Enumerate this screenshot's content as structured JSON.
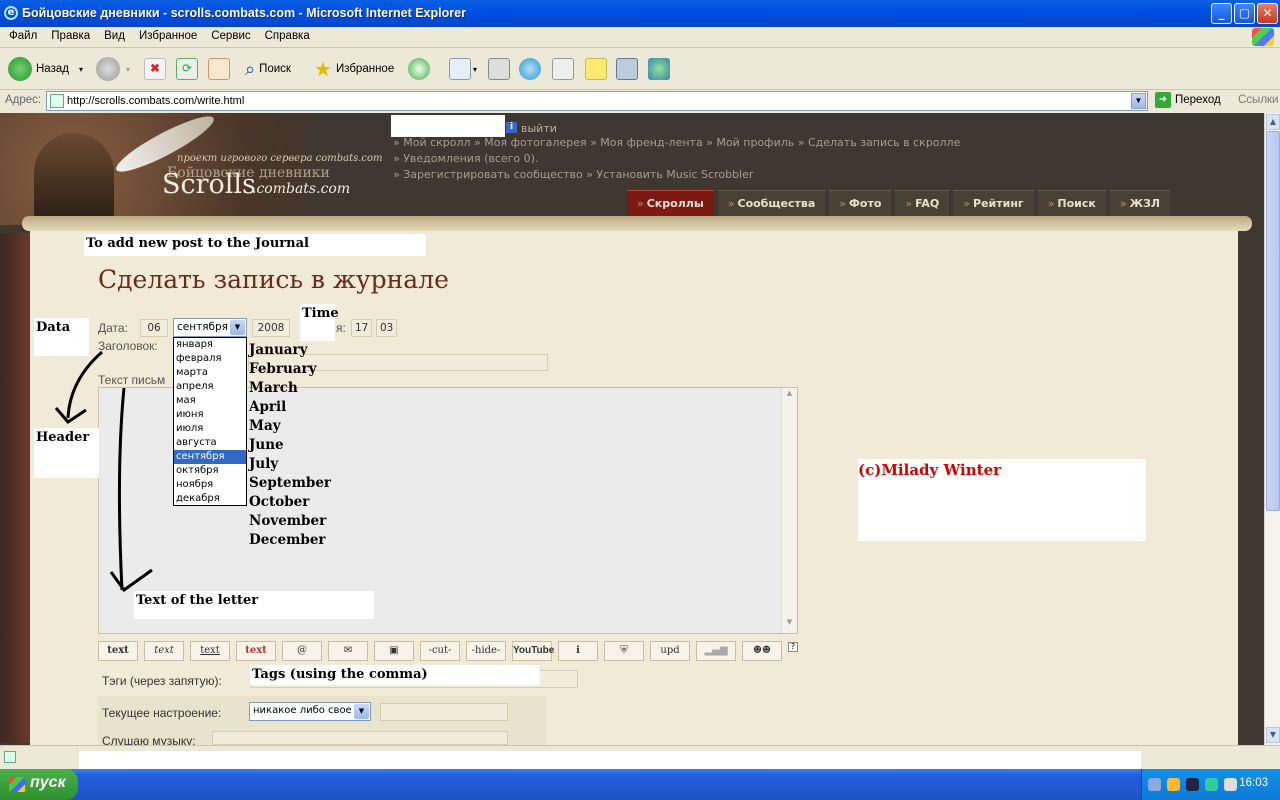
{
  "window": {
    "title": "Бойцовские дневники - scrolls.combats.com - Microsoft Internet Explorer",
    "controls": [
      "_",
      "▢",
      "✕"
    ]
  },
  "menu": [
    "Файл",
    "Правка",
    "Вид",
    "Избранное",
    "Сервис",
    "Справка"
  ],
  "toolbar": {
    "back": "Назад",
    "search": "Поиск",
    "favorites": "Избранное"
  },
  "addressbar": {
    "label": "Адрес:",
    "url": "http://scrolls.combats.com/write.html",
    "go": "Переход",
    "links": "Ссылки"
  },
  "site": {
    "project_line": "проект игрового сервера combats.com",
    "logo_ru": "Бойцовские дневники",
    "logo_en": "Scrolls",
    "logo_domain": ".combats.com",
    "logout": "выйти",
    "nav_line1": "» Мой скролл » Моя фотогалерея » Моя френд-лента » Мой профиль » Сделать запись в скролле",
    "nav_line2": "» Уведомления (всего 0).",
    "nav_line3": "» Зарегистрировать сообщество » Установить Music Scrobbler",
    "tabs": [
      "Скроллы",
      "Сообщества",
      "Фото",
      "FAQ",
      "Рейтинг",
      "Поиск",
      "ЖЗЛ"
    ],
    "tab_marker": "»"
  },
  "form": {
    "title": "Сделать запись в журнале",
    "date_label": "Дата:",
    "day": "06",
    "month_selected": "сентября",
    "year": "2008",
    "time_label_partial": "я:",
    "hour": "17",
    "minute": "03",
    "header_label": "Заголовок:",
    "text_label": "Текст письм",
    "months_ru": [
      "января",
      "февраля",
      "марта",
      "апреля",
      "мая",
      "июня",
      "июля",
      "августа",
      "сентября",
      "октября",
      "ноября",
      "декабря"
    ],
    "months_en": [
      "January",
      "February",
      "March",
      "April",
      "May",
      "June",
      "July",
      "September",
      "October",
      "November",
      "December"
    ],
    "format_buttons": [
      "text",
      "text",
      "text",
      "text",
      "",
      "",
      "",
      "-cut-",
      "-hide-",
      "YouTube",
      "",
      "",
      "upd",
      "",
      ""
    ],
    "help_glyph": "?",
    "tags_label": "Тэги (через запятую):",
    "mood_label": "Текущее настроение:",
    "mood_value": "никакое либо свое",
    "music_label": "Слушаю музыку:"
  },
  "annotations": {
    "add_post": "To add new post to the Journal",
    "data": "Data",
    "time": "Time",
    "header": "Header",
    "text_of_letter": "Text of the letter",
    "tags": "Tags (using the comma)",
    "copyright": "(c)Milady Winter"
  },
  "taskbar": {
    "start": "пуск",
    "clock": "16:03"
  },
  "colors": {
    "accent_tab": "#7a1a12",
    "copyright_red": "#d40000",
    "title_brown": "#6a2a1c"
  }
}
